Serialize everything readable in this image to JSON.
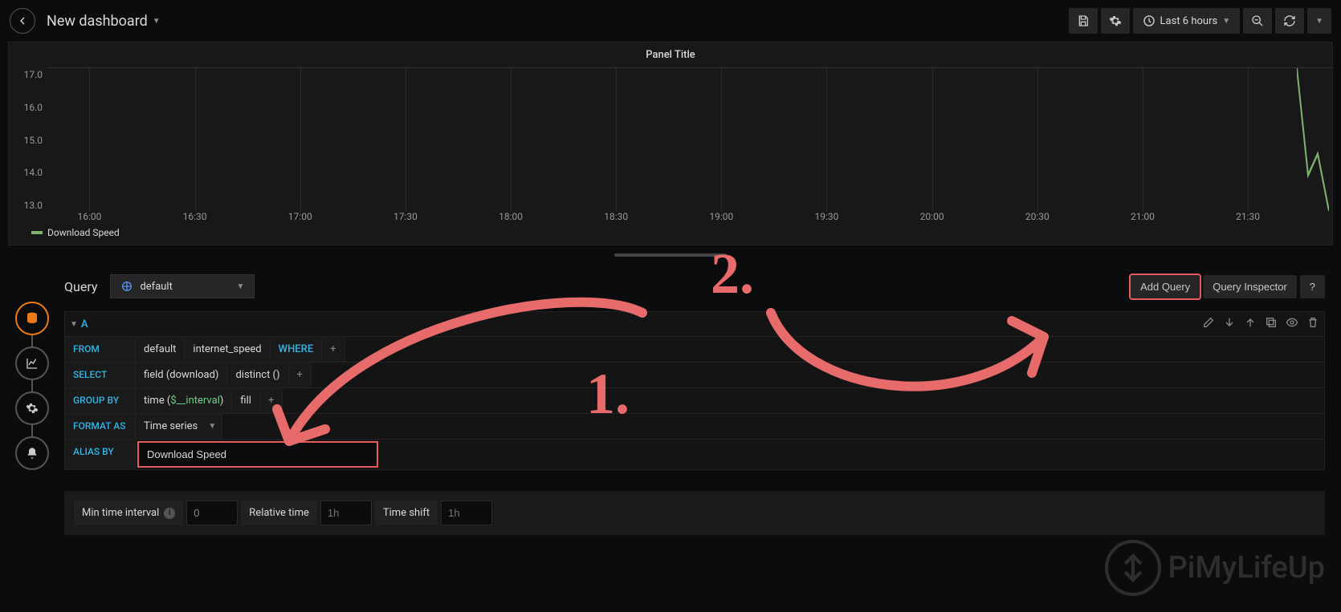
{
  "header": {
    "title": "New dashboard",
    "time_range": "Last 6 hours"
  },
  "panel": {
    "title": "Panel Title",
    "legend": "Download Speed"
  },
  "chart_data": {
    "type": "line",
    "title": "Panel Title",
    "xlabel": "",
    "ylabel": "",
    "ylim": [
      13.0,
      17.0
    ],
    "y_ticks": [
      "17.0",
      "16.0",
      "15.0",
      "14.0",
      "13.0"
    ],
    "x_ticks": [
      "16:00",
      "16:30",
      "17:00",
      "17:30",
      "18:00",
      "18:30",
      "19:00",
      "19:30",
      "20:00",
      "20:30",
      "21:00",
      "21:30"
    ],
    "series": [
      {
        "name": "Download Speed",
        "color": "#7eb26d",
        "x": [
          "21:38",
          "21:40",
          "21:42",
          "21:44"
        ],
        "values": [
          17.0,
          14.0,
          14.6,
          13.0
        ]
      }
    ]
  },
  "query": {
    "section_label": "Query",
    "datasource": "default",
    "add_query": "Add Query",
    "query_inspector": "Query Inspector",
    "help": "?",
    "letter": "A",
    "rows": {
      "from": {
        "label": "FROM",
        "retention": "default",
        "measurement": "internet_speed",
        "where": "WHERE"
      },
      "select": {
        "label": "SELECT",
        "field": "field (download)",
        "agg": "distinct ()"
      },
      "groupby": {
        "label": "GROUP BY",
        "time_prefix": "time (",
        "time_var": "$__interval",
        "time_suffix": ")",
        "fill": "fill"
      },
      "format": {
        "label": "FORMAT AS",
        "value": "Time series"
      },
      "alias": {
        "label": "ALIAS BY",
        "value": "Download Speed"
      }
    }
  },
  "options": {
    "min_interval_label": "Min time interval",
    "min_interval_value": "0",
    "relative_label": "Relative time",
    "relative_placeholder": "1h",
    "shift_label": "Time shift",
    "shift_placeholder": "1h"
  },
  "annotations": {
    "one": "1.",
    "two": "2."
  },
  "watermark": "PiMyLifeUp"
}
